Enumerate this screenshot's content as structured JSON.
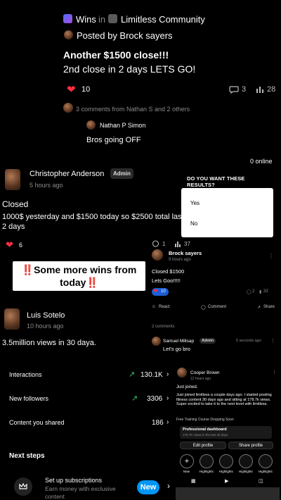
{
  "post1": {
    "space_icon": "wins-icon",
    "space": "Wins",
    "in_word": "in",
    "community": "Limitless Community",
    "posted_by": "Posted by Brock sayers",
    "headline": "Another $1500 close!!!",
    "body": "2nd close in 2 days LETS GO!",
    "likes": "10",
    "comments": "3",
    "views": "28",
    "comments_summary": "3 comments from Nathan S and 2 others",
    "reply_author": "Nathan P Simon",
    "reply_text": "Bros going OFF"
  },
  "online_count": "0 online",
  "post2": {
    "author": "Christopher Anderson",
    "role": "Admin",
    "time": "5 hours ago",
    "title": "Closed",
    "body": "1000$ yesterday and $1500 today so $2500 total last 2 days",
    "likes": "6",
    "comments": "1",
    "views": "37"
  },
  "survey": {
    "question": "DO YOU WANT THESE RESULTS?",
    "options": [
      "Yes",
      "No"
    ]
  },
  "overlay_post": {
    "author": "Brock sayers",
    "time": "9 hours ago",
    "title": "Closed $1500",
    "body": "Lets Goo!!!!!",
    "likes": "10",
    "comments": "2",
    "views": "33",
    "react_label": "React",
    "comment_label": "Comment",
    "share_label": "Share",
    "comments_count": "2 comments",
    "commenter": "Samuel Millsap",
    "commenter_role": "Admin",
    "commenter_time": "5 seconds ago",
    "comment_text": "Let's go bro"
  },
  "caption": {
    "line1": "‼️Some more wins from",
    "line2": "today‼️"
  },
  "post3": {
    "author": "Luis Sotelo",
    "time": "10 hours ago",
    "body": "3.5million views in 30 daya."
  },
  "insights": {
    "rows": [
      {
        "label": "Interactions",
        "value": "130.1K",
        "trend": "up"
      },
      {
        "label": "New followers",
        "value": "3306",
        "trend": "up"
      },
      {
        "label": "Content you shared",
        "value": "186",
        "trend": ""
      }
    ],
    "next_steps": "Next steps",
    "task_title": "Set up subscriptions",
    "task_subtitle": "Earn money with exclusive content",
    "new_label": "New"
  },
  "profile_panel": {
    "author": "Cooper Brown",
    "time": "12 hours ago",
    "intro": "Just joined.",
    "body": "Just joined limitless a couple days ago. I started posting fitness content 30 days ago and sitting at 178.7k views. Super excited to take it to the next level with limitless.",
    "promo": "Free Training Course Dropping Soon",
    "dashboard_title": "Professional dashboard",
    "dashboard_sub": "178.7K views in the last 30 days",
    "edit_profile": "Edit profile",
    "share_profile": "Share profile",
    "highlights": [
      "New",
      "Highlights",
      "Highlights",
      "Highlights",
      "Highlights"
    ]
  }
}
